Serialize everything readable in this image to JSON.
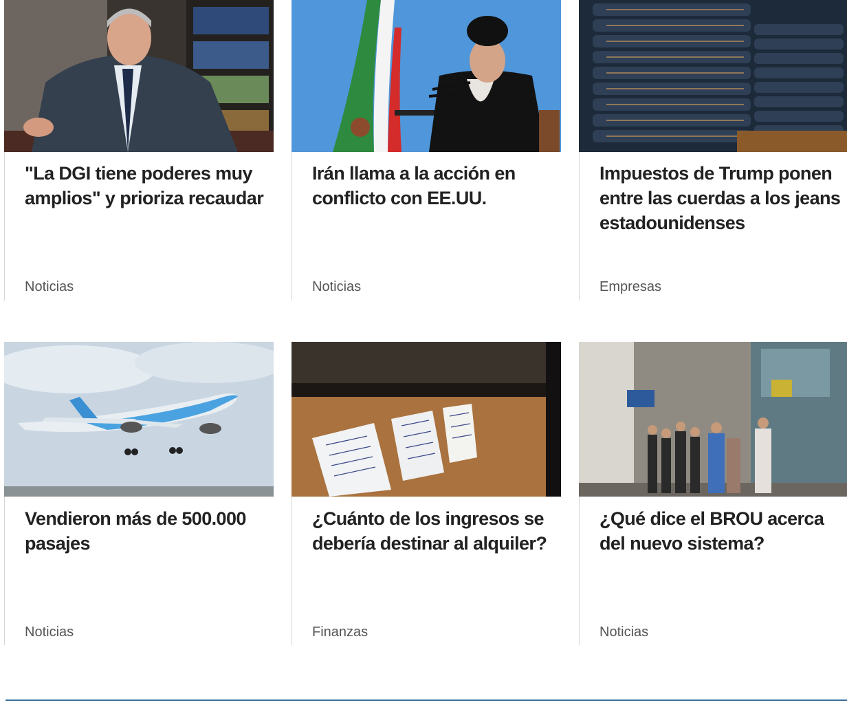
{
  "colors": {
    "headline": "#222222",
    "section": "#555555",
    "divider": "#3b6e9c"
  },
  "articles": [
    {
      "headline": "\"La DGI tiene poderes muy amplios\" y prioriza recaudar",
      "section": "Noticias",
      "image": "portrait-older-man-in-suit-library"
    },
    {
      "headline": "Irán llama a la acción en conflicto con EE.UU.",
      "section": "Noticias",
      "image": "cleric-speaking-iran-flag"
    },
    {
      "headline": "Impuestos de Trump ponen entre las cuerdas a los jeans estadounidenses",
      "section": "Empresas",
      "image": "stacked-denim-jeans"
    },
    {
      "headline": "Vendieron más de 500.000 pasajes",
      "section": "Noticias",
      "image": "airplane-takeoff"
    },
    {
      "headline": "¿Cuánto de los ingresos se debería destinar al alquiler?",
      "section": "Finanzas",
      "image": "rental-notices-in-window"
    },
    {
      "headline": "¿Qué dice el BROU acerca del nuevo sistema?",
      "section": "Noticias",
      "image": "people-queue-outside-bank"
    }
  ]
}
